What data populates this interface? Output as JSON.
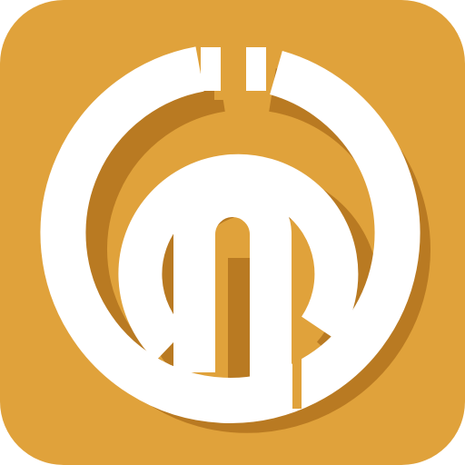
{
  "icon": {
    "name": "app-logo",
    "colors": {
      "background": "#E0A23B",
      "shadow": "#B97A22",
      "foreground": "#FFFFFF"
    }
  }
}
